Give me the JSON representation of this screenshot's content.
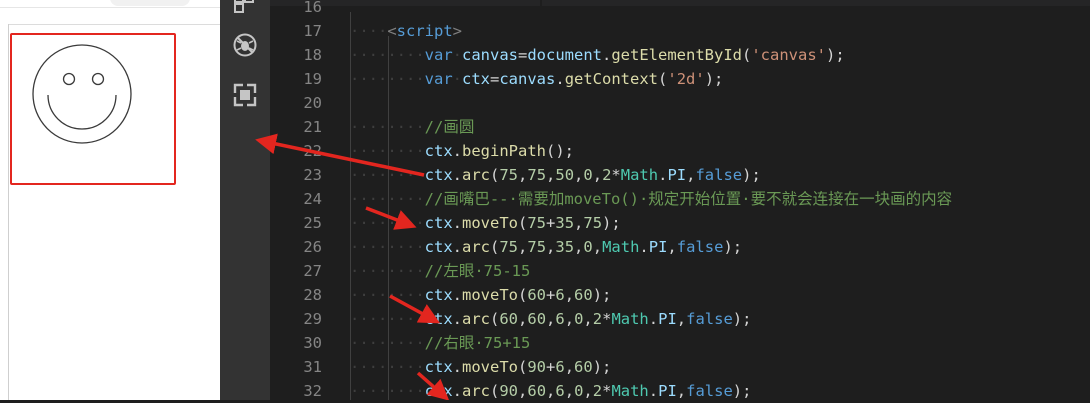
{
  "preview": {
    "has_canvas_border_highlight": true,
    "highlight_color": "#e3261f"
  },
  "activity_bar": {
    "icons": [
      "extensions-icon",
      "debug-disabled-icon",
      "remote-explorer-icon"
    ]
  },
  "editor": {
    "lines": [
      {
        "num": "16",
        "indent": "",
        "tokens": []
      },
      {
        "num": "17",
        "indent": "····",
        "tokens": [
          {
            "t": "<",
            "c": "t-tag"
          },
          {
            "t": "script",
            "c": "t-tagname"
          },
          {
            "t": ">",
            "c": "t-tag"
          }
        ]
      },
      {
        "num": "18",
        "indent": "········",
        "tokens": [
          {
            "t": "var",
            "c": "t-kw"
          },
          {
            "t": "·",
            "c": "ws"
          },
          {
            "t": "canvas",
            "c": "t-var"
          },
          {
            "t": "=",
            "c": "t-pun"
          },
          {
            "t": "document",
            "c": "t-var"
          },
          {
            "t": ".",
            "c": "t-pun"
          },
          {
            "t": "getElementById",
            "c": "t-fn"
          },
          {
            "t": "(",
            "c": "t-pun"
          },
          {
            "t": "'canvas'",
            "c": "t-str"
          },
          {
            "t": ");",
            "c": "t-pun"
          }
        ]
      },
      {
        "num": "19",
        "indent": "········",
        "tokens": [
          {
            "t": "var",
            "c": "t-kw"
          },
          {
            "t": "·",
            "c": "ws"
          },
          {
            "t": "ctx",
            "c": "t-var"
          },
          {
            "t": "=",
            "c": "t-pun"
          },
          {
            "t": "canvas",
            "c": "t-var"
          },
          {
            "t": ".",
            "c": "t-pun"
          },
          {
            "t": "getContext",
            "c": "t-fn"
          },
          {
            "t": "(",
            "c": "t-pun"
          },
          {
            "t": "'2d'",
            "c": "t-str"
          },
          {
            "t": ");",
            "c": "t-pun"
          }
        ]
      },
      {
        "num": "20",
        "indent": "",
        "tokens": []
      },
      {
        "num": "21",
        "indent": "········",
        "tokens": [
          {
            "t": "//画圆",
            "c": "t-cmt"
          }
        ]
      },
      {
        "num": "22",
        "indent": "········",
        "tokens": [
          {
            "t": "ctx",
            "c": "t-var"
          },
          {
            "t": ".",
            "c": "t-pun"
          },
          {
            "t": "beginPath",
            "c": "t-fn"
          },
          {
            "t": "();",
            "c": "t-pun"
          }
        ]
      },
      {
        "num": "23",
        "indent": "········",
        "tokens": [
          {
            "t": "ctx",
            "c": "t-var"
          },
          {
            "t": ".",
            "c": "t-pun"
          },
          {
            "t": "arc",
            "c": "t-fn"
          },
          {
            "t": "(",
            "c": "t-pun"
          },
          {
            "t": "75",
            "c": "t-num"
          },
          {
            "t": ",",
            "c": "t-pun"
          },
          {
            "t": "75",
            "c": "t-num"
          },
          {
            "t": ",",
            "c": "t-pun"
          },
          {
            "t": "50",
            "c": "t-num"
          },
          {
            "t": ",",
            "c": "t-pun"
          },
          {
            "t": "0",
            "c": "t-num"
          },
          {
            "t": ",",
            "c": "t-pun"
          },
          {
            "t": "2",
            "c": "t-num"
          },
          {
            "t": "*",
            "c": "t-pun"
          },
          {
            "t": "Math",
            "c": "t-cls"
          },
          {
            "t": ".",
            "c": "t-pun"
          },
          {
            "t": "PI",
            "c": "t-var"
          },
          {
            "t": ",",
            "c": "t-pun"
          },
          {
            "t": "false",
            "c": "t-kw"
          },
          {
            "t": ");",
            "c": "t-pun"
          }
        ]
      },
      {
        "num": "24",
        "indent": "········",
        "tokens": [
          {
            "t": "//画嘴巴--·需要加moveTo()·规定开始位置·要不就会连接在一块画的内容",
            "c": "t-cmt"
          }
        ]
      },
      {
        "num": "25",
        "indent": "········",
        "tokens": [
          {
            "t": "ctx",
            "c": "t-var"
          },
          {
            "t": ".",
            "c": "t-pun"
          },
          {
            "t": "moveTo",
            "c": "t-fn"
          },
          {
            "t": "(",
            "c": "t-pun"
          },
          {
            "t": "75",
            "c": "t-num"
          },
          {
            "t": "+",
            "c": "t-pun"
          },
          {
            "t": "35",
            "c": "t-num"
          },
          {
            "t": ",",
            "c": "t-pun"
          },
          {
            "t": "75",
            "c": "t-num"
          },
          {
            "t": ");",
            "c": "t-pun"
          }
        ]
      },
      {
        "num": "26",
        "indent": "········",
        "tokens": [
          {
            "t": "ctx",
            "c": "t-var"
          },
          {
            "t": ".",
            "c": "t-pun"
          },
          {
            "t": "arc",
            "c": "t-fn"
          },
          {
            "t": "(",
            "c": "t-pun"
          },
          {
            "t": "75",
            "c": "t-num"
          },
          {
            "t": ",",
            "c": "t-pun"
          },
          {
            "t": "75",
            "c": "t-num"
          },
          {
            "t": ",",
            "c": "t-pun"
          },
          {
            "t": "35",
            "c": "t-num"
          },
          {
            "t": ",",
            "c": "t-pun"
          },
          {
            "t": "0",
            "c": "t-num"
          },
          {
            "t": ",",
            "c": "t-pun"
          },
          {
            "t": "Math",
            "c": "t-cls"
          },
          {
            "t": ".",
            "c": "t-pun"
          },
          {
            "t": "PI",
            "c": "t-var"
          },
          {
            "t": ",",
            "c": "t-pun"
          },
          {
            "t": "false",
            "c": "t-kw"
          },
          {
            "t": ");",
            "c": "t-pun"
          }
        ]
      },
      {
        "num": "27",
        "indent": "········",
        "tokens": [
          {
            "t": "//左眼·75-15",
            "c": "t-cmt"
          }
        ]
      },
      {
        "num": "28",
        "indent": "········",
        "tokens": [
          {
            "t": "ctx",
            "c": "t-var"
          },
          {
            "t": ".",
            "c": "t-pun"
          },
          {
            "t": "moveTo",
            "c": "t-fn"
          },
          {
            "t": "(",
            "c": "t-pun"
          },
          {
            "t": "60",
            "c": "t-num"
          },
          {
            "t": "+",
            "c": "t-pun"
          },
          {
            "t": "6",
            "c": "t-num"
          },
          {
            "t": ",",
            "c": "t-pun"
          },
          {
            "t": "60",
            "c": "t-num"
          },
          {
            "t": ");",
            "c": "t-pun"
          }
        ]
      },
      {
        "num": "29",
        "indent": "········",
        "tokens": [
          {
            "t": "ctx",
            "c": "t-var"
          },
          {
            "t": ".",
            "c": "t-pun"
          },
          {
            "t": "arc",
            "c": "t-fn"
          },
          {
            "t": "(",
            "c": "t-pun"
          },
          {
            "t": "60",
            "c": "t-num"
          },
          {
            "t": ",",
            "c": "t-pun"
          },
          {
            "t": "60",
            "c": "t-num"
          },
          {
            "t": ",",
            "c": "t-pun"
          },
          {
            "t": "6",
            "c": "t-num"
          },
          {
            "t": ",",
            "c": "t-pun"
          },
          {
            "t": "0",
            "c": "t-num"
          },
          {
            "t": ",",
            "c": "t-pun"
          },
          {
            "t": "2",
            "c": "t-num"
          },
          {
            "t": "*",
            "c": "t-pun"
          },
          {
            "t": "Math",
            "c": "t-cls"
          },
          {
            "t": ".",
            "c": "t-pun"
          },
          {
            "t": "PI",
            "c": "t-var"
          },
          {
            "t": ",",
            "c": "t-pun"
          },
          {
            "t": "false",
            "c": "t-kw"
          },
          {
            "t": ");",
            "c": "t-pun"
          }
        ]
      },
      {
        "num": "30",
        "indent": "········",
        "tokens": [
          {
            "t": "//右眼·75+15",
            "c": "t-cmt"
          }
        ]
      },
      {
        "num": "31",
        "indent": "········",
        "tokens": [
          {
            "t": "ctx",
            "c": "t-var"
          },
          {
            "t": ".",
            "c": "t-pun"
          },
          {
            "t": "moveTo",
            "c": "t-fn"
          },
          {
            "t": "(",
            "c": "t-pun"
          },
          {
            "t": "90",
            "c": "t-num"
          },
          {
            "t": "+",
            "c": "t-pun"
          },
          {
            "t": "6",
            "c": "t-num"
          },
          {
            "t": ",",
            "c": "t-pun"
          },
          {
            "t": "60",
            "c": "t-num"
          },
          {
            "t": ");",
            "c": "t-pun"
          }
        ]
      },
      {
        "num": "32",
        "indent": "········",
        "tokens": [
          {
            "t": "ctx",
            "c": "t-var"
          },
          {
            "t": ".",
            "c": "t-pun"
          },
          {
            "t": "arc",
            "c": "t-fn"
          },
          {
            "t": "(",
            "c": "t-pun"
          },
          {
            "t": "90",
            "c": "t-num"
          },
          {
            "t": ",",
            "c": "t-pun"
          },
          {
            "t": "60",
            "c": "t-num"
          },
          {
            "t": ",",
            "c": "t-pun"
          },
          {
            "t": "6",
            "c": "t-num"
          },
          {
            "t": ",",
            "c": "t-pun"
          },
          {
            "t": "0",
            "c": "t-num"
          },
          {
            "t": ",",
            "c": "t-pun"
          },
          {
            "t": "2",
            "c": "t-num"
          },
          {
            "t": "*",
            "c": "t-pun"
          },
          {
            "t": "Math",
            "c": "t-cls"
          },
          {
            "t": ".",
            "c": "t-pun"
          },
          {
            "t": "PI",
            "c": "t-var"
          },
          {
            "t": ",",
            "c": "t-pun"
          },
          {
            "t": "false",
            "c": "t-kw"
          },
          {
            "t": ");",
            "c": "t-pun"
          }
        ]
      }
    ]
  },
  "annotations": {
    "arrow_color": "#e3261f"
  }
}
